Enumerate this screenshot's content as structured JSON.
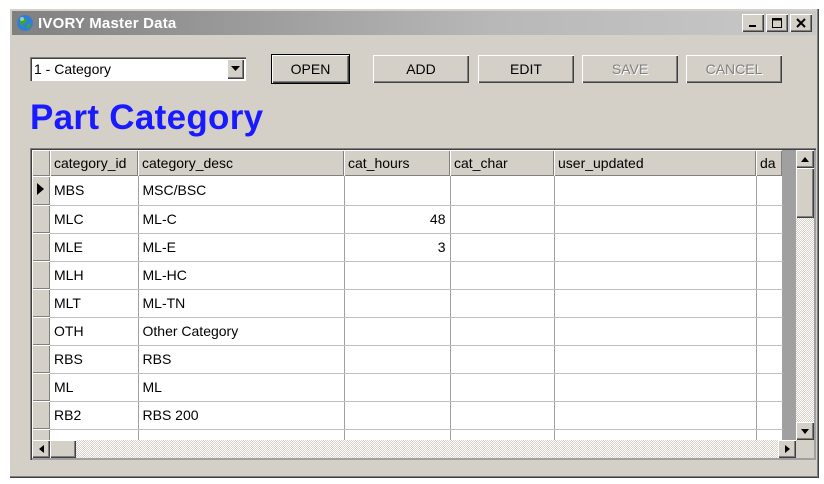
{
  "window": {
    "title": "IVORY Master Data",
    "icon": "globe-icon",
    "controls": [
      "minimize-icon",
      "maximize-icon",
      "close-icon"
    ]
  },
  "toolbar": {
    "selector_value": "1 - Category",
    "open_label": "OPEN",
    "add_label": "ADD",
    "edit_label": "EDIT",
    "save_label": "SAVE",
    "cancel_label": "CANCEL"
  },
  "page_title": "Part Category",
  "grid": {
    "columns": [
      "category_id",
      "category_desc",
      "cat_hours",
      "cat_char",
      "user_updated",
      "da"
    ],
    "rows": [
      {
        "category_id": "MBS",
        "category_desc": "MSC/BSC",
        "cat_hours": "",
        "cat_char": "",
        "user_updated": "",
        "da": "",
        "current": true
      },
      {
        "category_id": "MLC",
        "category_desc": "ML-C",
        "cat_hours": "48",
        "cat_char": "",
        "user_updated": "",
        "da": ""
      },
      {
        "category_id": "MLE",
        "category_desc": "ML-E",
        "cat_hours": "3",
        "cat_char": "",
        "user_updated": "",
        "da": ""
      },
      {
        "category_id": "MLH",
        "category_desc": "ML-HC",
        "cat_hours": "",
        "cat_char": "",
        "user_updated": "",
        "da": ""
      },
      {
        "category_id": "MLT",
        "category_desc": "ML-TN",
        "cat_hours": "",
        "cat_char": "",
        "user_updated": "",
        "da": ""
      },
      {
        "category_id": "OTH",
        "category_desc": "Other Category",
        "cat_hours": "",
        "cat_char": "",
        "user_updated": "",
        "da": ""
      },
      {
        "category_id": "RBS",
        "category_desc": "RBS",
        "cat_hours": "",
        "cat_char": "",
        "user_updated": "",
        "da": ""
      },
      {
        "category_id": "ML",
        "category_desc": "ML",
        "cat_hours": "",
        "cat_char": "",
        "user_updated": "",
        "da": ""
      },
      {
        "category_id": "RB2",
        "category_desc": "RBS 200",
        "cat_hours": "",
        "cat_char": "",
        "user_updated": "",
        "da": ""
      },
      {
        "category_id": "",
        "category_desc": "",
        "cat_hours": "",
        "cat_char": "",
        "user_updated": "",
        "da": ""
      }
    ]
  },
  "colors": {
    "heading": "#1a1aff",
    "face": "#d4d0c8",
    "title_bar": "#808080"
  }
}
